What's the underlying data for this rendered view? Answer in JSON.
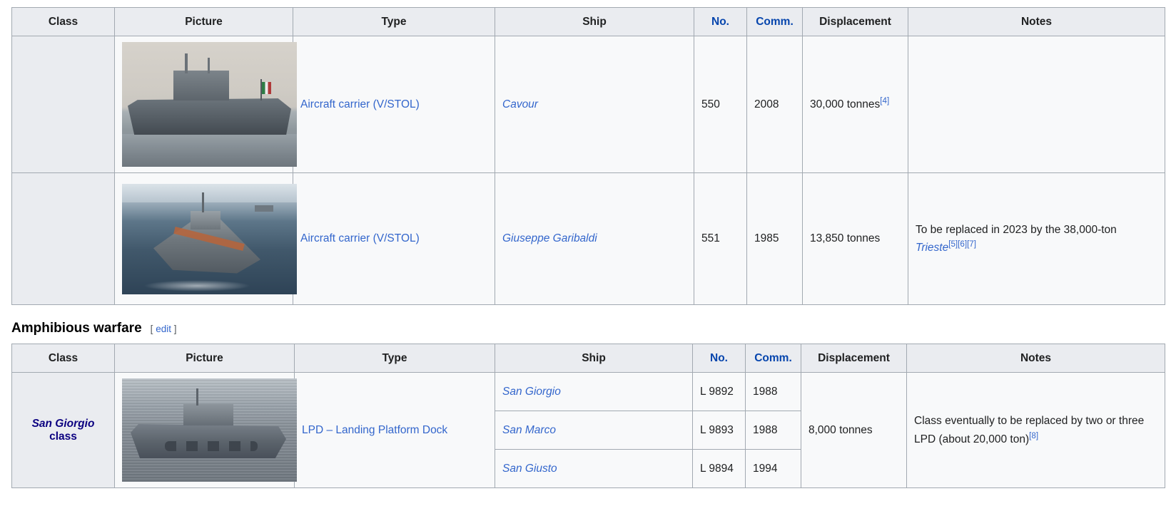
{
  "tables": {
    "carriers": {
      "headers": [
        "Class",
        "Picture",
        "Type",
        "Ship",
        "No.",
        "Comm.",
        "Displacement",
        "Notes"
      ],
      "rows": [
        {
          "class": "",
          "picture_alt": "Italian aircraft carrier Cavour at sea",
          "type": "Aircraft carrier (V/STOL)",
          "ship": "Cavour",
          "no": "550",
          "comm": "2008",
          "displacement": "30,000 tonnes",
          "displacement_refs": [
            "[4]"
          ],
          "notes": "",
          "notes_refs": []
        },
        {
          "class": "",
          "picture_alt": "Italian aircraft carrier Giuseppe Garibaldi underway",
          "type": "Aircraft carrier (V/STOL)",
          "ship": "Giuseppe Garibaldi",
          "no": "551",
          "comm": "1985",
          "displacement": "13,850 tonnes",
          "displacement_refs": [],
          "notes_prefix": "To be replaced in 2023 by the 38,000-ton ",
          "notes_link": "Trieste",
          "notes_refs": [
            "[5]",
            "[6]",
            "[7]"
          ]
        }
      ]
    },
    "amphibious": {
      "heading": "Amphibious warfare",
      "edit_label": "edit",
      "edit_bracket_open": "[",
      "edit_bracket_close": "]",
      "headers": [
        "Class",
        "Picture",
        "Type",
        "Ship",
        "No.",
        "Comm.",
        "Displacement",
        "Notes"
      ],
      "class_name": "San Giorgio",
      "class_word": "class",
      "picture_alt": "San Giorgio class amphibious transport dock at sea",
      "type": "LPD – Landing Platform Dock",
      "displacement": "8,000 tonnes",
      "notes_text": "Class eventually to be replaced by two or three LPD (about 20,000 ton)",
      "notes_refs": [
        "[8]"
      ],
      "ships": [
        {
          "ship": "San Giorgio",
          "no": "L 9892",
          "comm": "1988"
        },
        {
          "ship": "San Marco",
          "no": "L 9893",
          "comm": "1988"
        },
        {
          "ship": "San Giusto",
          "no": "L 9894",
          "comm": "1994"
        }
      ]
    }
  },
  "colors": {
    "link": "#3366cc",
    "visited_link": "#0b0080",
    "header_bg": "#eaecf0",
    "cell_bg": "#f8f9fa",
    "border": "#a2a9b1",
    "text": "#202122"
  }
}
